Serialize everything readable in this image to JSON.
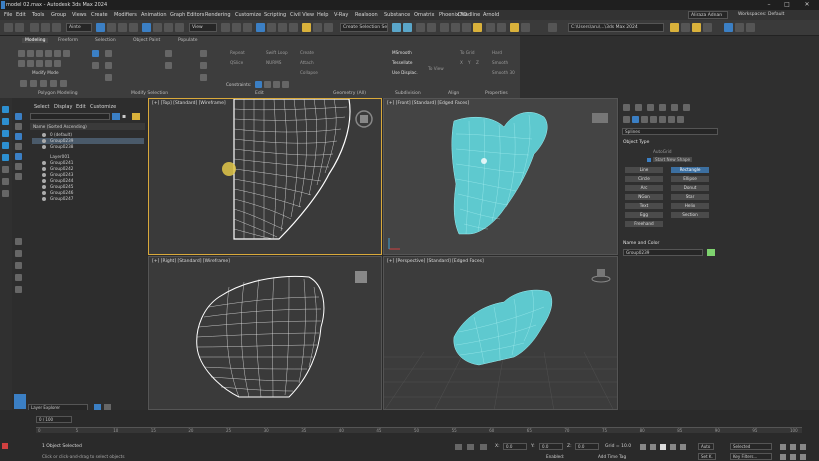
{
  "titlebar": {
    "title": "model 02.max - Autodesk 3ds Max 2024"
  },
  "menus": [
    "File",
    "Edit",
    "Tools",
    "Group",
    "Views",
    "Create",
    "Modifiers",
    "Animation",
    "Graph Editors",
    "Rendering",
    "Customize",
    "Scripting",
    "Civil View",
    "Help",
    "V-Ray",
    "Realsoon",
    "Substance",
    "Ornatrix",
    "Phoenix FD",
    "Deadline",
    "Arnold"
  ],
  "account": {
    "user": "Aliraza Adnan",
    "workspace_label": "Workspaces:",
    "workspace_value": "Default"
  },
  "toolbar": {
    "filter": "Ainte",
    "selection_set": "Create Selection Set",
    "path": "C:\\Users\\aru\\...\\3ds Max 2024",
    "view": "View"
  },
  "ribbon": {
    "tabs": [
      "Modeling",
      "Freeform",
      "Selection",
      "Object Paint",
      "Populate"
    ],
    "mode_label": "Modify Mode",
    "groups": [
      "Polygon Modeling",
      "Modify Selection",
      "Edit",
      "Geometry (All)",
      "Subdivision",
      "Align",
      "Properties"
    ],
    "edit_items": [
      "Repeat",
      "QSlice",
      "Swift Loop",
      "NURMS",
      "Create",
      "Attach",
      "Collapse",
      "Constraints:"
    ],
    "subdiv_items": [
      "MSmooth",
      "Tessellate",
      "Use Displac."
    ],
    "align_items": [
      "To View",
      "To Grid",
      "X",
      "Y",
      "Z"
    ],
    "props_items": [
      "Hard",
      "Smooth",
      "Smooth 30"
    ]
  },
  "scene_explorer": {
    "tabs": [
      "Select",
      "Display",
      "Edit",
      "Customize"
    ],
    "header": "Name (Sorted Ascending)",
    "rows": [
      {
        "label": "0 (default)",
        "selected": false
      },
      {
        "label": "Group0239",
        "selected": true
      },
      {
        "label": "Group0238",
        "selected": false
      },
      {
        "label": "Layer001",
        "selected": false
      },
      {
        "label": "Group0241",
        "selected": false
      },
      {
        "label": "Group0242",
        "selected": false
      },
      {
        "label": "Group0243",
        "selected": false
      },
      {
        "label": "Group0244",
        "selected": false
      },
      {
        "label": "Group0245",
        "selected": false
      },
      {
        "label": "Group0246",
        "selected": false
      },
      {
        "label": "Group0247",
        "selected": false
      }
    ],
    "layer_explorer": "Layer Explorer"
  },
  "viewports": {
    "top": "[+] [Top] [Standard] [Wireframe]",
    "front": "[+] [Front] [Standard] [Edged Faces]",
    "right": "[+] [Right] [Standard] [Wireframe]",
    "perspective": "[+] [Perspective] [Standard] [Edged Faces]"
  },
  "command_panel": {
    "category": "Splines",
    "object_type_header": "Object Type",
    "autogrid": "AutoGrid",
    "start_new_shape": "Start New Shape",
    "buttons": [
      "Line",
      "Rectangle",
      "Circle",
      "Ellipse",
      "Arc",
      "Donut",
      "NGon",
      "Star",
      "Text",
      "Helix",
      "Egg",
      "Section",
      "Freehand"
    ],
    "selected_button": "Rectangle",
    "name_color_header": "Name and Color",
    "object_name": "Group0239",
    "swatch_color": "#7ed36f"
  },
  "timeline": {
    "frame_display": "0 / 100",
    "ticks": [
      "0",
      "5",
      "10",
      "15",
      "20",
      "25",
      "30",
      "35",
      "40",
      "45",
      "50",
      "55",
      "60",
      "65",
      "70",
      "75",
      "80",
      "85",
      "90",
      "95",
      "100"
    ]
  },
  "status": {
    "selection": "1 Object Selected",
    "prompt": "Click or click-and-drag to select objects",
    "x_label": "X:",
    "x_value": "0.0",
    "y_label": "Y:",
    "y_value": "0.0",
    "z_label": "Z:",
    "z_value": "0.0",
    "grid": "Grid = 10.0",
    "add_time_tag": "Add Time Tag",
    "enabled_label": "Enabled:",
    "auto": "Auto",
    "set_key": "Set K.",
    "key_mode": "Selected",
    "key_filters": "Key Filters..."
  },
  "colors": {
    "accent": "#3b7fc4",
    "mesh": "#5ec9cf"
  }
}
